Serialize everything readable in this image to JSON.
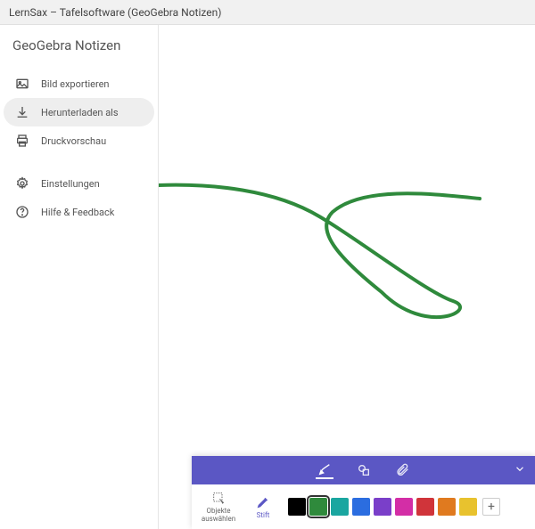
{
  "window": {
    "title": "LernSax – Tafelsoftware (GeoGebra Notizen)"
  },
  "sidebar": {
    "title": "GeoGebra Notizen",
    "items": [
      {
        "label": "Bild exportieren",
        "icon": "image-icon"
      },
      {
        "label": "Herunterladen als",
        "icon": "download-icon",
        "selected": true
      },
      {
        "label": "Druckvorschau",
        "icon": "print-icon"
      },
      {
        "label": "Einstellungen",
        "icon": "gear-icon"
      },
      {
        "label": "Hilfe & Feedback",
        "icon": "help-icon"
      }
    ]
  },
  "canvas": {
    "stroke_color": "#2f8a3c",
    "stroke_width": 4
  },
  "toolbar": {
    "accent": "#5b57c4",
    "header_tabs": [
      {
        "name": "pen-tab",
        "active": true
      },
      {
        "name": "shapes-tab",
        "active": false
      },
      {
        "name": "attach-tab",
        "active": false
      }
    ],
    "tools": [
      {
        "label": "Objekte auswählen",
        "name": "select-tool",
        "active": false
      },
      {
        "label": "Stift",
        "name": "pen-tool",
        "active": true
      }
    ],
    "swatches": [
      {
        "hex": "#000000",
        "selected": false
      },
      {
        "hex": "#2f8a3c",
        "selected": true
      },
      {
        "hex": "#1aa6a0",
        "selected": false
      },
      {
        "hex": "#2b6de0",
        "selected": false
      },
      {
        "hex": "#7a3fc9",
        "selected": false
      },
      {
        "hex": "#d32ea6",
        "selected": false
      },
      {
        "hex": "#d0343a",
        "selected": false
      },
      {
        "hex": "#e07a1f",
        "selected": false
      },
      {
        "hex": "#e8c22e",
        "selected": false
      }
    ],
    "add_label": "+"
  }
}
